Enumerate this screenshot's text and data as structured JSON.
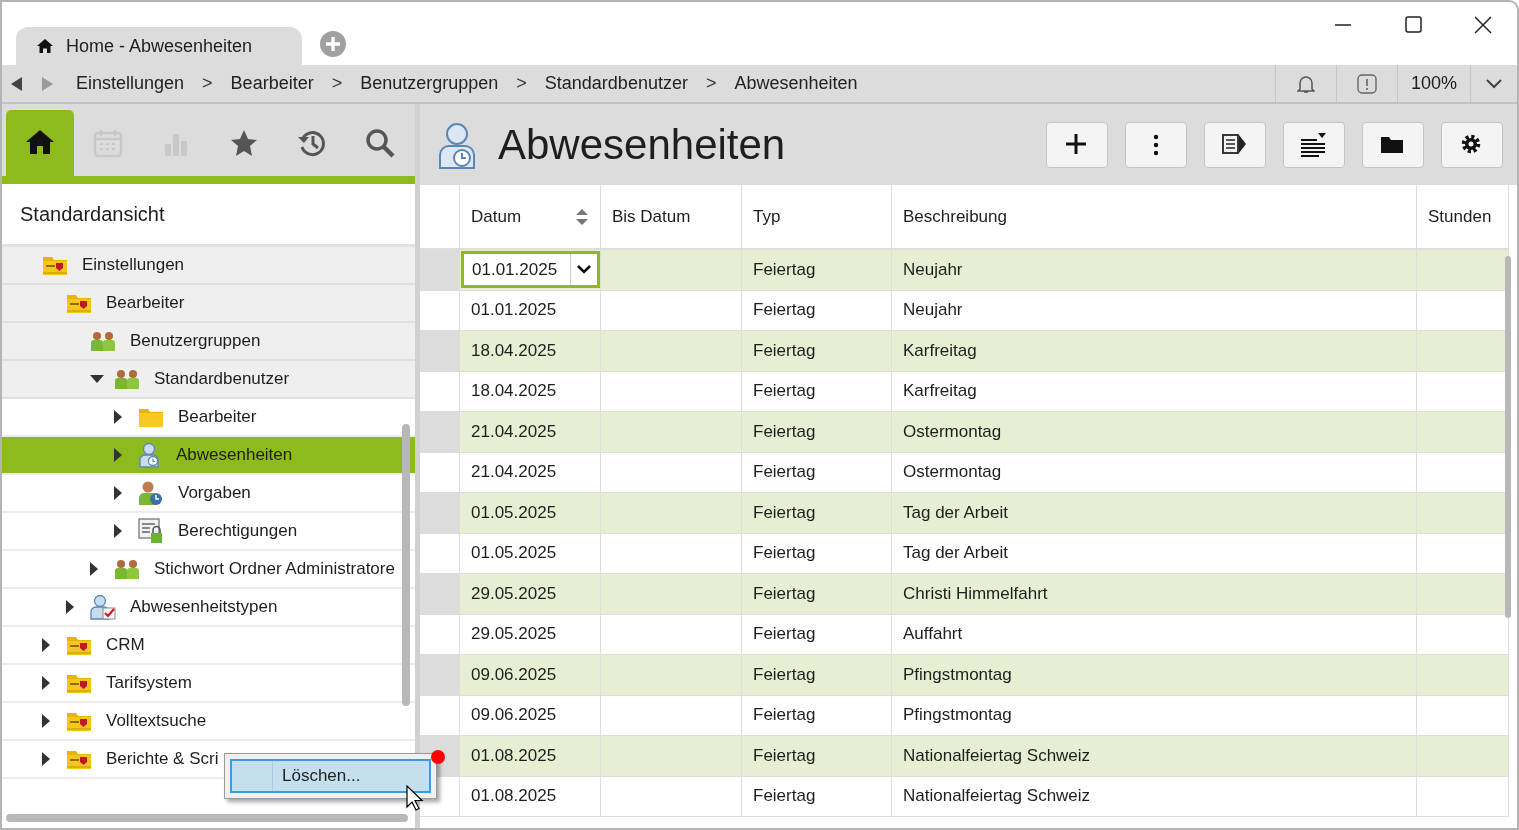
{
  "window": {
    "tab_title": "Home - Abwesenheiten"
  },
  "breadcrumb": {
    "items": [
      {
        "kind": "crumb",
        "label": "Einstellungen"
      },
      {
        "kind": "separator",
        "label": ">"
      },
      {
        "kind": "crumb",
        "label": "Bearbeiter"
      },
      {
        "kind": "separator",
        "label": ">"
      },
      {
        "kind": "crumb",
        "label": "Benutzergruppen"
      },
      {
        "kind": "separator",
        "label": ">"
      },
      {
        "kind": "crumb",
        "label": "Standardbenutzer"
      },
      {
        "kind": "separator",
        "label": ">"
      },
      {
        "kind": "crumb",
        "label": "Abwesenheiten"
      }
    ],
    "zoom": "100%"
  },
  "nav_tabs": [
    {
      "kind": "home",
      "selected": true,
      "disabled": false
    },
    {
      "kind": "calendar",
      "selected": false,
      "disabled": true
    },
    {
      "kind": "chart",
      "selected": false,
      "disabled": true
    },
    {
      "kind": "star",
      "selected": false,
      "disabled": false
    },
    {
      "kind": "history",
      "selected": false,
      "disabled": false
    },
    {
      "kind": "search",
      "selected": false,
      "disabled": false
    }
  ],
  "sidebar": {
    "view_title": "Standardansicht",
    "tree": [
      {
        "label": "Einstellungen",
        "kind": "settings-folder",
        "pinned": true,
        "selected": false,
        "children": [
          {
            "label": "Bearbeiter",
            "kind": "settings-folder",
            "pinned": true,
            "selected": false,
            "children": [
              {
                "label": "Benutzergruppen",
                "kind": "group",
                "pinned": true,
                "selected": false,
                "children": [
                  {
                    "label": "Standardbenutzer",
                    "kind": "group",
                    "pinned": true,
                    "selected": false,
                    "expanded": true,
                    "children": [
                      {
                        "label": "Bearbeiter",
                        "kind": "folder",
                        "pinned": false,
                        "selected": false,
                        "expanded": false
                      },
                      {
                        "label": "Abwesenheiten",
                        "kind": "absence",
                        "pinned": false,
                        "selected": true,
                        "expanded": false
                      },
                      {
                        "label": "Vorgaben",
                        "kind": "defaults",
                        "pinned": false,
                        "selected": false,
                        "expanded": false
                      },
                      {
                        "label": "Berechtigungen",
                        "kind": "permissions",
                        "pinned": false,
                        "selected": false,
                        "expanded": false
                      }
                    ]
                  },
                  {
                    "label": "Stichwort Ordner Administratore",
                    "kind": "group",
                    "pinned": false,
                    "selected": false,
                    "expanded": false
                  }
                ]
              },
              {
                "label": "Abwesenheitstypen",
                "kind": "absence-types",
                "pinned": false,
                "selected": false,
                "expanded": false
              }
            ]
          },
          {
            "label": "CRM",
            "kind": "settings-folder",
            "pinned": false,
            "selected": false,
            "expanded": false
          },
          {
            "label": "Tarifsystem",
            "kind": "settings-folder",
            "pinned": false,
            "selected": false,
            "expanded": false
          },
          {
            "label": "Volltextsuche",
            "kind": "settings-folder",
            "pinned": false,
            "selected": false,
            "expanded": false
          },
          {
            "label": "Berichte & Scri",
            "kind": "settings-folder",
            "pinned": false,
            "selected": false,
            "expanded": false
          }
        ]
      }
    ]
  },
  "context_menu": {
    "items": [
      "Löschen..."
    ]
  },
  "content": {
    "title": "Abwesenheiten",
    "toolbar": [
      {
        "kind": "add"
      },
      {
        "kind": "more"
      },
      {
        "kind": "export"
      },
      {
        "kind": "list"
      },
      {
        "kind": "folder"
      },
      {
        "kind": "settings"
      }
    ],
    "table": {
      "columns": [
        "Datum",
        "Bis Datum",
        "Typ",
        "Beschreibung",
        "Stunden"
      ],
      "rows": [
        {
          "datum": "01.01.2025",
          "typ": "Feiertag",
          "beschreibung": "Neujahr",
          "editing": true
        },
        {
          "datum": "01.01.2025",
          "typ": "Feiertag",
          "beschreibung": "Neujahr",
          "editing": false
        },
        {
          "datum": "18.04.2025",
          "typ": "Feiertag",
          "beschreibung": "Karfreitag",
          "editing": false
        },
        {
          "datum": "18.04.2025",
          "typ": "Feiertag",
          "beschreibung": "Karfreitag",
          "editing": false
        },
        {
          "datum": "21.04.2025",
          "typ": "Feiertag",
          "beschreibung": "Ostermontag",
          "editing": false
        },
        {
          "datum": "21.04.2025",
          "typ": "Feiertag",
          "beschreibung": "Ostermontag",
          "editing": false
        },
        {
          "datum": "01.05.2025",
          "typ": "Feiertag",
          "beschreibung": "Tag der Arbeit",
          "editing": false
        },
        {
          "datum": "01.05.2025",
          "typ": "Feiertag",
          "beschreibung": "Tag der Arbeit",
          "editing": false
        },
        {
          "datum": "29.05.2025",
          "typ": "Feiertag",
          "beschreibung": "Christi Himmelfahrt",
          "editing": false
        },
        {
          "datum": "29.05.2025",
          "typ": "Feiertag",
          "beschreibung": "Auffahrt",
          "editing": false
        },
        {
          "datum": "09.06.2025",
          "typ": "Feiertag",
          "beschreibung": "Pfingstmontag",
          "editing": false
        },
        {
          "datum": "09.06.2025",
          "typ": "Feiertag",
          "beschreibung": "Pfingstmontag",
          "editing": false
        },
        {
          "datum": "01.08.2025",
          "typ": "Feiertag",
          "beschreibung": "Nationalfeiertag Schweiz",
          "editing": false
        },
        {
          "datum": "01.08.2025",
          "typ": "Feiertag",
          "beschreibung": "Nationalfeiertag Schweiz",
          "editing": false
        }
      ]
    }
  }
}
